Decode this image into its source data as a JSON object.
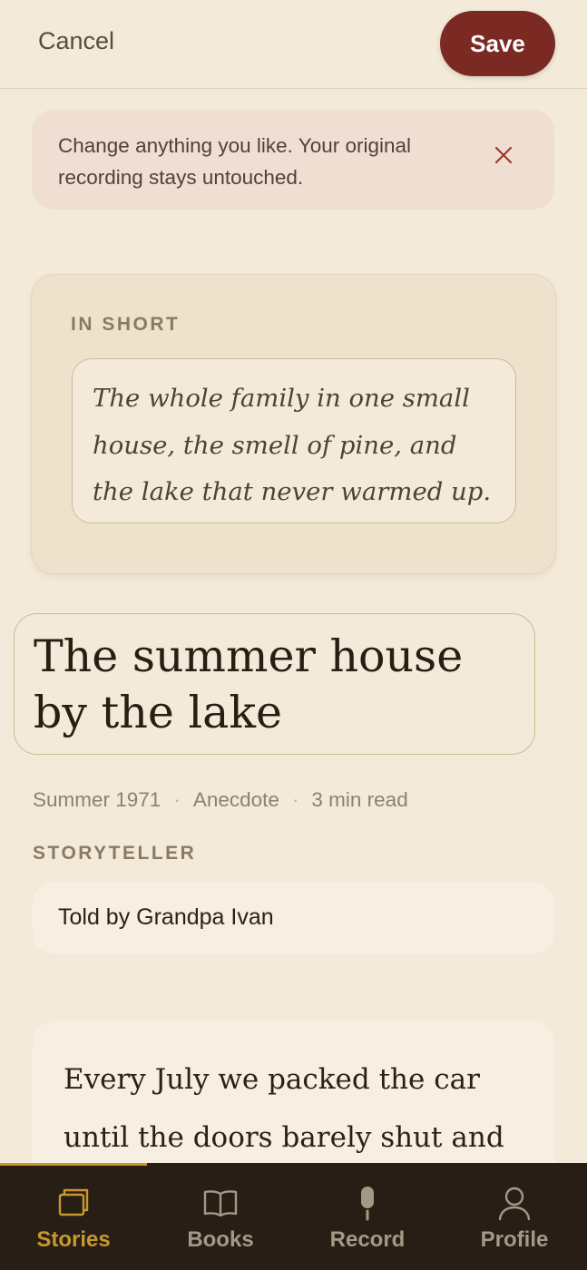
{
  "header": {
    "cancel_label": "Cancel",
    "save_label": "Save"
  },
  "notice": {
    "text": "Change anything you like. Your original recording stays untouched."
  },
  "summary": {
    "label": "IN SHORT",
    "text": "The whole family in one small house, the smell of pine, and the lake that never warmed up."
  },
  "story": {
    "title": "The summer house by the lake",
    "meta": {
      "date": "Summer 1971",
      "category": "Anecdote",
      "read_time": "3 min read"
    },
    "storyteller_label": "STORYTELLER",
    "storyteller_value": "Told by Grandpa Ivan",
    "body": "Every July we packed the car until the doors barely shut and"
  },
  "nav": {
    "items": [
      {
        "label": "Stories",
        "icon": "stories-icon",
        "active": true
      },
      {
        "label": "Books",
        "icon": "book-icon",
        "active": false
      },
      {
        "label": "Record",
        "icon": "microphone-icon",
        "active": false
      },
      {
        "label": "Profile",
        "icon": "profile-icon",
        "active": false
      }
    ]
  },
  "colors": {
    "background": "#f4ead9",
    "accent": "#7a2a23",
    "nav_active": "#c9972e",
    "nav_background": "#271e16"
  }
}
